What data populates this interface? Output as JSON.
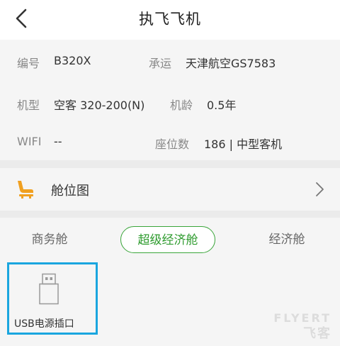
{
  "header": {
    "title": "执飞飞机"
  },
  "info": {
    "registration_label": "编号",
    "registration_value": "B320X",
    "carrier_label": "承运",
    "carrier_value": "天津航空GS7583",
    "model_label": "机型",
    "model_value": "空客 320-200(N)",
    "age_label": "机龄",
    "age_value": "0.5年",
    "wifi_label": "WIFI",
    "wifi_value": "--",
    "seats_label": "座位数",
    "seats_value": "186 | 中型客机"
  },
  "seatmap": {
    "label": "舱位图"
  },
  "tabs": [
    {
      "label": "商务舱",
      "active": false
    },
    {
      "label": "超级经济舱",
      "active": true
    },
    {
      "label": "经济舱",
      "active": false
    }
  ],
  "facilities": [
    {
      "label": "USB电源插口",
      "icon": "usb-icon"
    }
  ],
  "watermark": {
    "line1": "FLYERT",
    "line2": "飞客"
  },
  "colors": {
    "accent_green": "#2e9b2e",
    "highlight_blue": "#1aa6df",
    "seat_orange": "#f0a020"
  }
}
